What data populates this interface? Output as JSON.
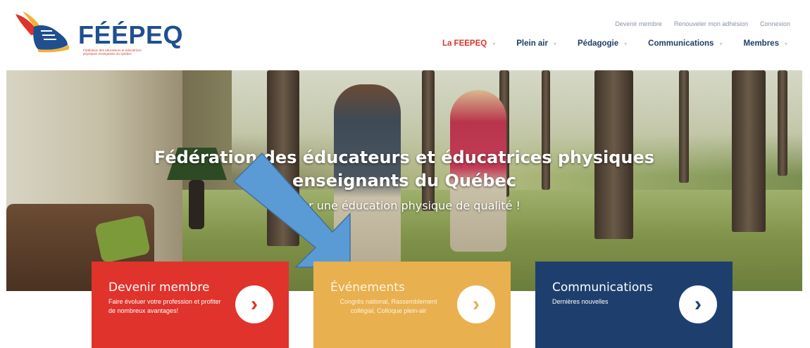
{
  "logo": {
    "name": "FÉÉPEQ",
    "subtitle_lines": [
      "Fédération des éducateurs et éducatrices",
      "physiques enseignants du Québec"
    ]
  },
  "utility_nav": [
    "Devenir membre",
    "Renouveler mon adhésion",
    "Connexion"
  ],
  "main_nav": [
    {
      "label": "La FEEPEQ",
      "active": true
    },
    {
      "label": "Plein air",
      "active": false
    },
    {
      "label": "Pédagogie",
      "active": false
    },
    {
      "label": "Communications",
      "active": false
    },
    {
      "label": "Membres",
      "active": false
    }
  ],
  "hero": {
    "title_line1": "Fédération des éducateurs et éducatrices physiques",
    "title_line2": "enseignants du Québec",
    "tagline": "Pour une éducation physique de qualité !"
  },
  "cards": [
    {
      "title": "Devenir membre",
      "text": "Faire évoluer votre profession et profiter de nombreux avantages!",
      "color": "#e0332b"
    },
    {
      "title": "Événements",
      "text": "Congrès national, Rassemblement collégial, Colloque plein-air",
      "color": "#e9b04f"
    },
    {
      "title": "Communications",
      "text": "Dernières nouvelles",
      "color": "#1e3f6e"
    }
  ],
  "colors": {
    "brand_blue": "#1f4f8f",
    "brand_red": "#d9352a",
    "nav_text": "#1e3c66",
    "annotation_arrow": "#5b9bd5"
  }
}
